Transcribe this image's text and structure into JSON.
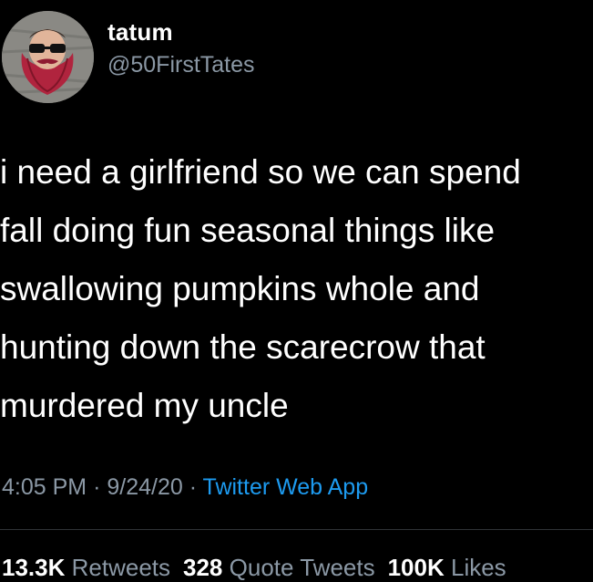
{
  "user": {
    "display_name": "tatum",
    "handle": "@50FirstTates"
  },
  "tweet": {
    "text": "i need a girlfriend so we can spend\nfall doing fun seasonal things like\nswallowing pumpkins whole and\nhunting down the scarecrow that\nmurdered my uncle",
    "time": "4:05 PM",
    "date": "9/24/20",
    "source": "Twitter Web App",
    "separator": "·"
  },
  "stats": {
    "retweets_count": "13.3K",
    "retweets_label": "Retweets",
    "quotes_count": "328",
    "quotes_label": "Quote Tweets",
    "likes_count": "100K",
    "likes_label": "Likes"
  },
  "colors": {
    "background": "#000000",
    "text": "#ffffff",
    "secondary": "#8b98a5",
    "link": "#1d9bf0"
  },
  "icons": {
    "avatar": "bearded-man-sunglasses-avatar"
  }
}
